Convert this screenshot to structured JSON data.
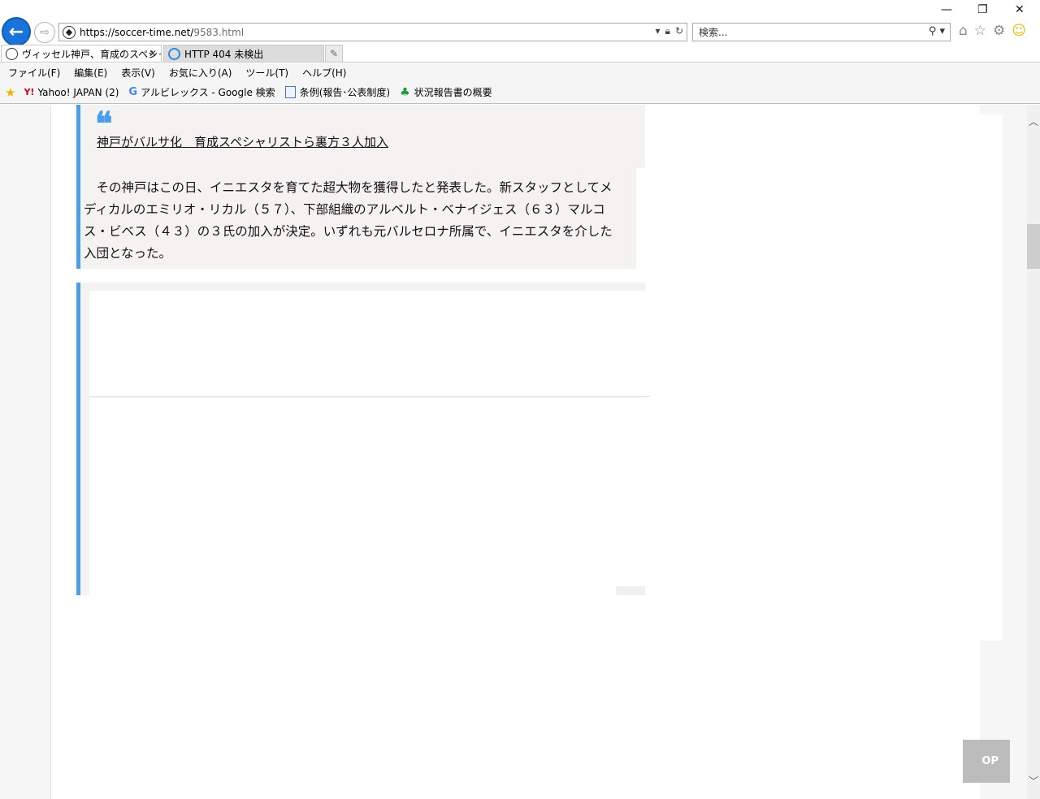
{
  "browser": {
    "url_host": "https://soccer-time.net/",
    "url_path": "9583.html",
    "search_placeholder": "検索...",
    "tabs": [
      {
        "label": "ヴィッセル神戸、育成のスペシャ...",
        "active": true
      },
      {
        "label": "HTTP 404 未検出",
        "active": false
      }
    ],
    "menu": [
      "ファイル(F)",
      "編集(E)",
      "表示(V)",
      "お気に入り(A)",
      "ツール(T)",
      "ヘルプ(H)"
    ],
    "favorites": [
      {
        "label": "Yahoo! JAPAN (2)",
        "icon": "yahoo-icon"
      },
      {
        "label": "アルビレックス - Google 検索",
        "icon": "google-icon"
      },
      {
        "label": "条例(報告･公表制度)",
        "icon": "ie-page-icon"
      },
      {
        "label": "状況報告書の概要",
        "icon": "leaf-icon"
      }
    ],
    "accent": "#1a73d9"
  },
  "article": {
    "quote_link": "神戸がバルサ化　育成スペシャリストら裏方３人加入",
    "body": "　その神戸はこの日、イニエスタを育てた超大物を獲得したと発表した。新スタッフとしてメディカルのエミリオ・リカル（５７）、下部組織のアルベルト・ベナイジェス（６３）マルコス・ビベス（４３）の３氏の加入が決定。いずれも元バルセロナ所属で、イニエスタを介した入団となった。",
    "quote_color": "#4d9ee8"
  },
  "page": {
    "top_button_label": "OP"
  }
}
